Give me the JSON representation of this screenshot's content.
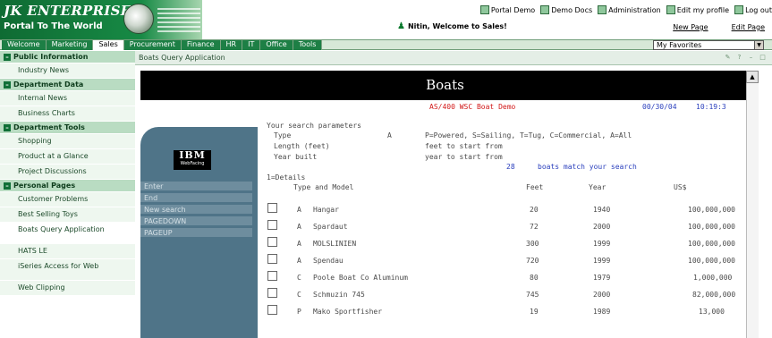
{
  "header": {
    "brand": "JK ENTERPRISES",
    "subtitle": "Portal To The World",
    "links": [
      "Portal Demo",
      "Demo Docs",
      "Administration",
      "Edit my profile",
      "Log out"
    ],
    "welcome": "Nitin, Welcome to Sales!",
    "new_page": "New Page",
    "edit_page": "Edit Page"
  },
  "nav": {
    "tabs": [
      "Welcome",
      "Marketing",
      "Sales",
      "Procurement",
      "Finance",
      "HR",
      "IT",
      "Office",
      "Tools"
    ],
    "active_tab": "Sales",
    "favorites": "My Favorites"
  },
  "sidebar": {
    "sections": [
      {
        "title": "Public Information",
        "items": [
          "Industry News"
        ]
      },
      {
        "title": "Department Data",
        "items": [
          "Internal News",
          "Business Charts"
        ]
      },
      {
        "title": "Department Tools",
        "items": [
          "Shopping",
          "Product at a Glance",
          "Project Discussions"
        ]
      },
      {
        "title": "Personal Pages",
        "items": [
          "Customer Problems",
          "Best Selling Toys",
          "Boats Query Application",
          "HATS LE",
          "iSeries Access for Web",
          "Web Clipping"
        ]
      }
    ]
  },
  "portlet": {
    "title": "Boats Query Application",
    "icons": [
      "✎",
      "?",
      "–",
      "□"
    ]
  },
  "app": {
    "banner": "Boats",
    "logo_top": "IBM",
    "logo_bottom": "WebFacing",
    "function_keys": [
      "Enter",
      "End",
      "New search",
      "PAGEDOWN",
      "PAGEUP"
    ],
    "demo_title": "AS/400 WSC Boat Demo",
    "date": "00/30/04",
    "time": "10:19:3",
    "search_heading": "Your search parameters",
    "param_type_label": "Type",
    "param_type_value": "A",
    "param_type_help": "P=Powered, S=Sailing, T=Tug, C=Commercial, A=All",
    "param_length_label": "Length (feet)",
    "param_length_help": "feet to start from",
    "param_year_label": "Year built",
    "param_year_help": "year to start from",
    "match_count": "28",
    "match_text": "boats match your search",
    "details_label": "1=Details",
    "columns": {
      "model": "Type and Model",
      "feet": "Feet",
      "year": "Year",
      "price": "US$"
    },
    "rows": [
      {
        "type": "A",
        "model": "Hangar",
        "feet": "20",
        "year": "1940",
        "price": "100,000,000"
      },
      {
        "type": "A",
        "model": "Spardaut",
        "feet": "72",
        "year": "2000",
        "price": "100,000,000"
      },
      {
        "type": "A",
        "model": "MOLSLINIEN",
        "feet": "300",
        "year": "1999",
        "price": "100,000,000"
      },
      {
        "type": "A",
        "model": "Spendau",
        "feet": "720",
        "year": "1999",
        "price": "100,000,000"
      },
      {
        "type": "C",
        "model": "Poole Boat Co Aluminum",
        "feet": "80",
        "year": "1979",
        "price": "1,000,000"
      },
      {
        "type": "C",
        "model": "Schmuzin 745",
        "feet": "745",
        "year": "2000",
        "price": "82,000,000"
      },
      {
        "type": "P",
        "model": "Mako Sportfisher",
        "feet": "19",
        "year": "1989",
        "price": "13,000"
      }
    ]
  }
}
